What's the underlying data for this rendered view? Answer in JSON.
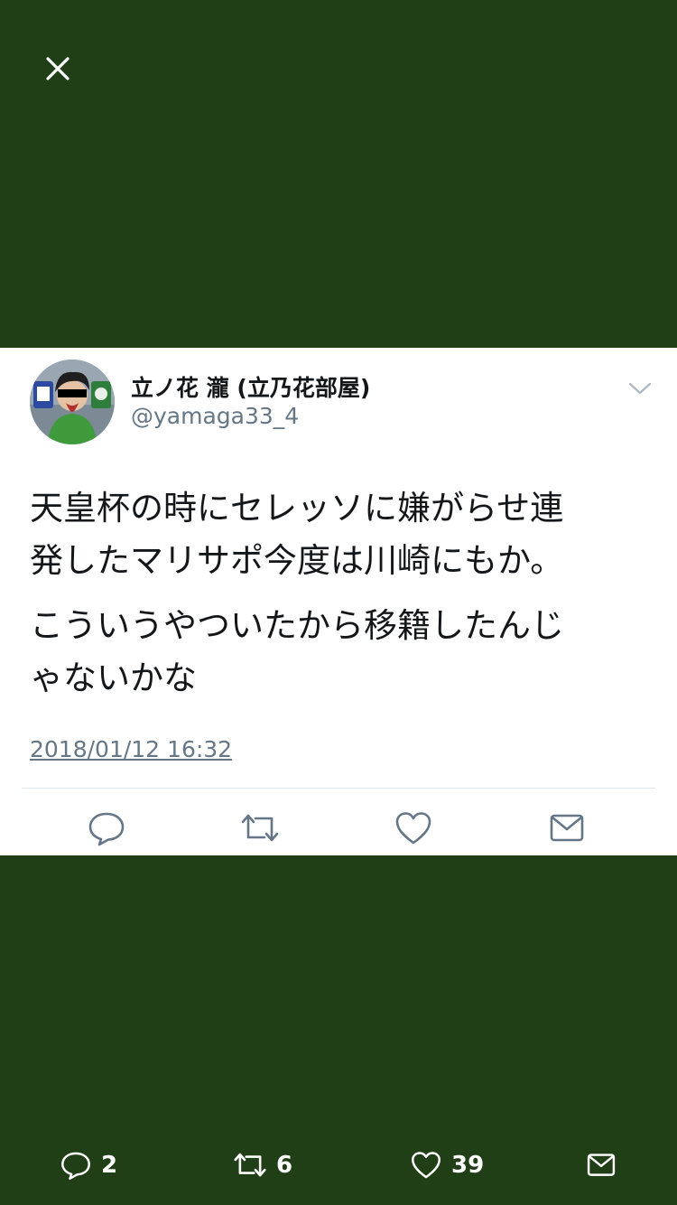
{
  "overlay": {
    "close_icon": "close-icon",
    "background_color": "#213f16"
  },
  "tweet": {
    "avatar_icon": "user-avatar",
    "display_name": "立ノ花 瀧 (立乃花部屋)",
    "handle": "@yamaga33_4",
    "menu_icon": "chevron-down-icon",
    "paragraphs": [
      "天皇杯の時にセレッソに嫌がらせ連\n発したマリサポ今度は川崎にもか。",
      "こういうやついたから移籍したんじ\nゃないかな"
    ],
    "timestamp": "2018/01/12 16:32",
    "actions": [
      {
        "icon": "reply-icon"
      },
      {
        "icon": "retweet-icon"
      },
      {
        "icon": "heart-icon"
      },
      {
        "icon": "mail-icon"
      }
    ]
  },
  "bottom_bar": {
    "reply_count": "2",
    "retweet_count": "6",
    "like_count": "39",
    "icons": [
      "reply-icon",
      "retweet-icon",
      "heart-icon",
      "mail-icon"
    ]
  }
}
